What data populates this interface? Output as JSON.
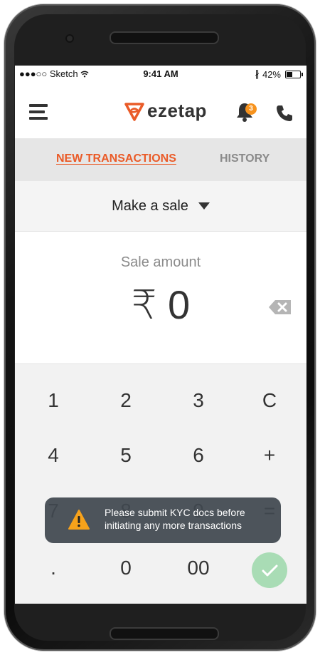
{
  "status_bar": {
    "carrier": "●●●○○ Sketch",
    "wifi_icon": "wifi-icon",
    "time": "9:41 AM",
    "bluetooth": "∦",
    "battery_percent": "42%",
    "battery_level": 0.42
  },
  "header": {
    "brand": "ezetap",
    "notification_count": "3",
    "accent_color": "#ea5b28",
    "badge_color": "#f7931e"
  },
  "tabs": {
    "new_transactions": "NEW TRANSACTIONS",
    "history": "HISTORY"
  },
  "sale_mode": {
    "label": "Make a sale"
  },
  "amount": {
    "label": "Sale amount",
    "value": "₹ 0"
  },
  "keypad": {
    "k1": "1",
    "k2": "2",
    "k3": "3",
    "kc": "C",
    "k4": "4",
    "k5": "5",
    "k6": "6",
    "kplus": "+",
    "k7": "7",
    "k8": "8",
    "k9": "9",
    "keq": "=",
    "kdot": ".",
    "k0": "0",
    "k00": "00"
  },
  "toast": {
    "message": "Please submit KYC docs before initiating any more transactions"
  }
}
